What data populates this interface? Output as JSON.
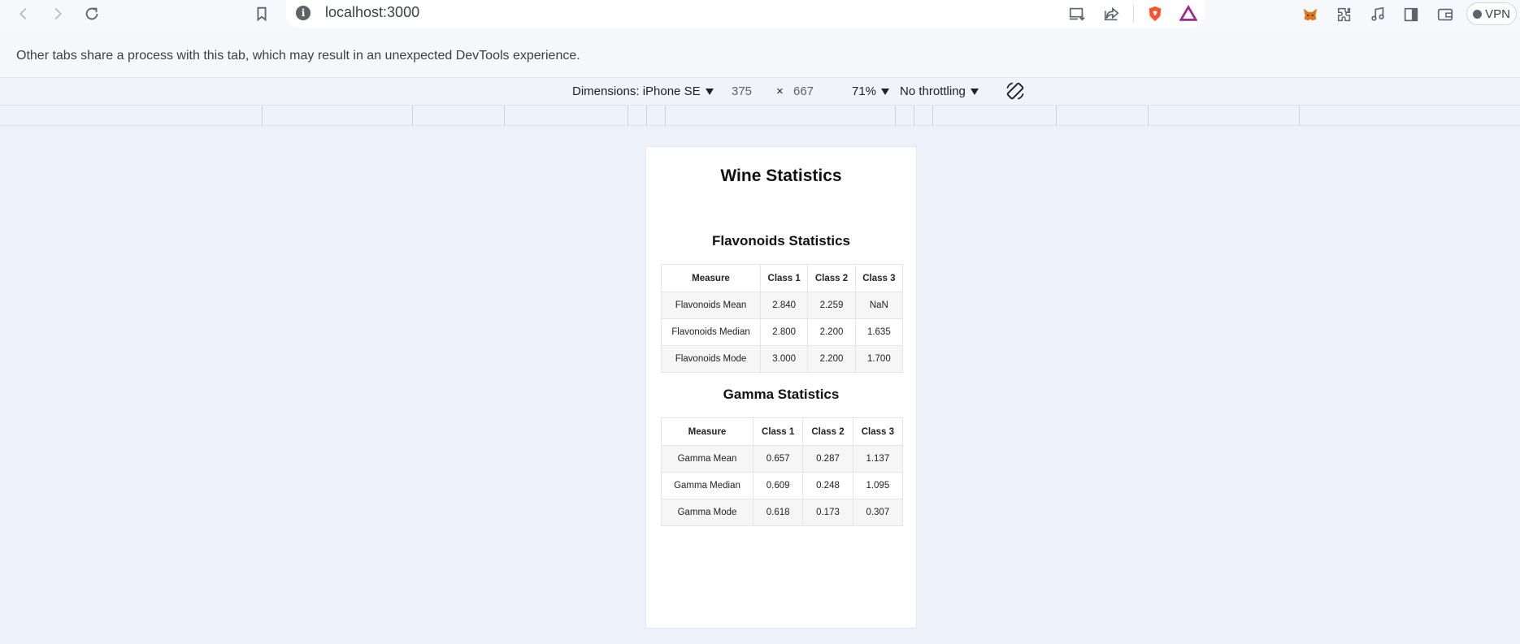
{
  "browser": {
    "url": "localhost:3000",
    "vpn_label": "VPN",
    "icons": [
      "back-icon",
      "forward-icon",
      "reload-icon",
      "bookmark-icon",
      "site-info-icon",
      "install-app-icon",
      "share-icon",
      "brave-shields-icon",
      "brave-rewards-icon",
      "metamask-icon",
      "extensions-icon",
      "media-icon",
      "sidebar-icon",
      "wallet-icon"
    ]
  },
  "devtools": {
    "warning": "Other tabs share a process with this tab, which may result in an unexpected DevTools experience.",
    "dimensions_label": "Dimensions: iPhone SE",
    "width": "375",
    "times": "×",
    "height": "667",
    "zoom": "71%",
    "throttling": "No throttling"
  },
  "page": {
    "title": "Wine Statistics",
    "flavonoids": {
      "heading": "Flavonoids Statistics",
      "columns": [
        "Measure",
        "Class 1",
        "Class 2",
        "Class 3"
      ],
      "rows": [
        [
          "Flavonoids Mean",
          "2.840",
          "2.259",
          "NaN"
        ],
        [
          "Flavonoids Median",
          "2.800",
          "2.200",
          "1.635"
        ],
        [
          "Flavonoids Mode",
          "3.000",
          "2.200",
          "1.700"
        ]
      ]
    },
    "gamma": {
      "heading": "Gamma Statistics",
      "columns": [
        "Measure",
        "Class 1",
        "Class 2",
        "Class 3"
      ],
      "rows": [
        [
          "Gamma Mean",
          "0.657",
          "0.287",
          "1.137"
        ],
        [
          "Gamma Median",
          "0.609",
          "0.248",
          "1.095"
        ],
        [
          "Gamma Mode",
          "0.618",
          "0.173",
          "0.307"
        ]
      ]
    }
  },
  "colors": {
    "brave_orange": "#fb542b",
    "rewards_purple": "#a0288c",
    "metamask_orange": "#e2761b"
  }
}
